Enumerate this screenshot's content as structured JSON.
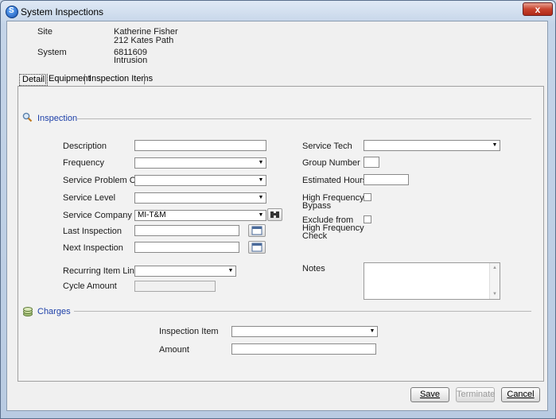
{
  "window": {
    "title": "System Inspections",
    "close_label": "x"
  },
  "header": {
    "site_label": "Site",
    "site_name": "Katherine Fisher",
    "site_address": "212 Kates Path",
    "system_label": "System",
    "system_number": "6811609",
    "system_type": "Intrusion"
  },
  "tabs": [
    {
      "label": "Detail",
      "active": true
    },
    {
      "label": "Equipment"
    },
    {
      "label": "Inspection Items"
    }
  ],
  "inspection": {
    "section_title": "Inspection",
    "description_label": "Description",
    "description_value": "",
    "frequency_label": "Frequency",
    "frequency_value": "",
    "service_problem_code_label": "Service Problem Code",
    "service_problem_code_value": "",
    "service_level_label": "Service Level",
    "service_level_value": "",
    "service_company_label": "Service Company",
    "service_company_value": "MI-T&M",
    "last_inspection_label": "Last Inspection",
    "last_inspection_value": "",
    "next_inspection_label": "Next Inspection",
    "next_inspection_value": "",
    "recurring_item_link_label": "Recurring Item Link",
    "recurring_item_link_value": "",
    "cycle_amount_label": "Cycle Amount",
    "cycle_amount_value": "",
    "service_tech_label": "Service Tech",
    "service_tech_value": "",
    "group_number_label": "Group Number",
    "group_number_value": "",
    "estimated_hours_label": "Estimated Hours",
    "estimated_hours_value": "",
    "high_frequency_bypass_label_1": "High Frequency",
    "high_frequency_bypass_label_2": "Bypass",
    "exclude_label_1": "Exclude from",
    "exclude_label_2": "High Frequency",
    "exclude_label_3": "Check",
    "notes_label": "Notes",
    "notes_value": ""
  },
  "charges": {
    "section_title": "Charges",
    "inspection_item_label": "Inspection Item",
    "inspection_item_value": "",
    "amount_label": "Amount",
    "amount_value": ""
  },
  "footer": {
    "save_label": "Save",
    "terminate_label": "Terminate",
    "cancel_label": "Cancel"
  },
  "colors": {
    "section_title": "#1c3fa8",
    "close_button": "#c8432e"
  }
}
